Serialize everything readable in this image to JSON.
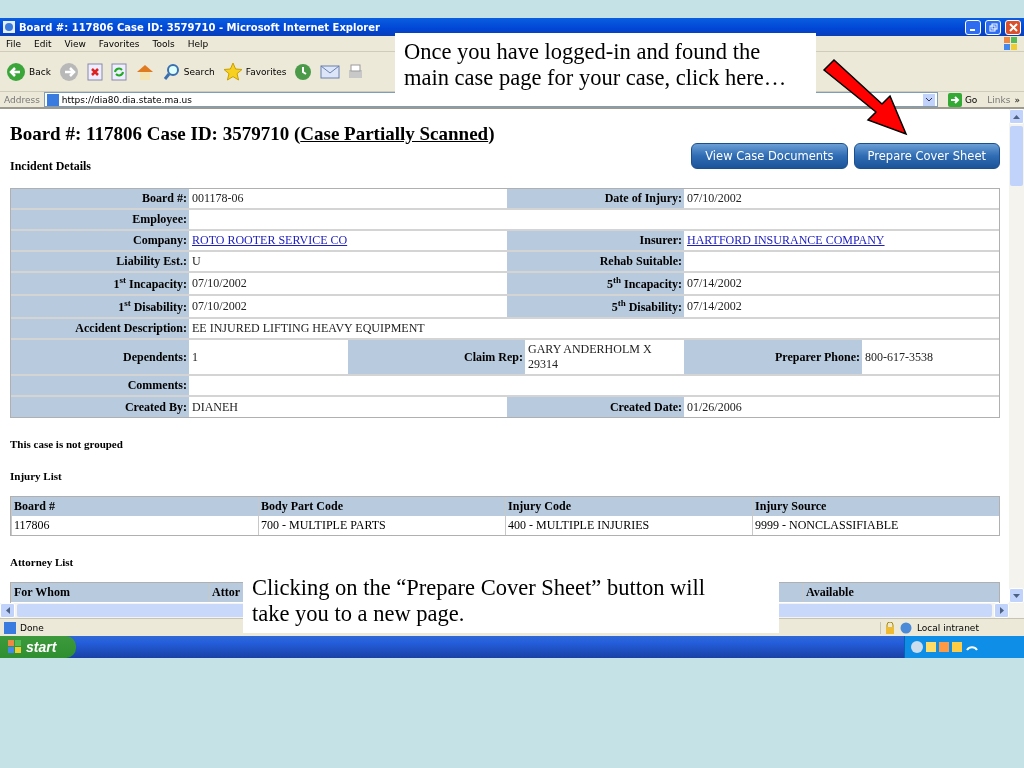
{
  "window": {
    "title": "Board #: 117806 Case ID: 3579710 - Microsoft Internet Explorer"
  },
  "menu": [
    "File",
    "Edit",
    "View",
    "Favorites",
    "Tools",
    "Help"
  ],
  "toolbar": [
    {
      "kind": "back",
      "label": "Back"
    },
    {
      "kind": "forward"
    },
    {
      "kind": "stop"
    },
    {
      "kind": "refresh"
    },
    {
      "kind": "home"
    },
    {
      "kind": "search",
      "label": "Search"
    },
    {
      "kind": "favorites",
      "label": "Favorites"
    },
    {
      "kind": "history"
    },
    {
      "kind": "mail"
    },
    {
      "kind": "print"
    }
  ],
  "address": {
    "label": "Address",
    "value": "https://dia80.dia.state.ma.us",
    "go": "Go",
    "links": "Links",
    "more": "»"
  },
  "page": {
    "title": {
      "before": "Board #: 117806 Case ID: 3579710 (",
      "link": "Case Partially Scanned",
      "after": ")"
    },
    "buttons": [
      "View Case Documents",
      "Prepare Cover Sheet"
    ],
    "section": "Incident Details",
    "details": [
      [
        {
          "label": "Board #:",
          "value": "001178-06",
          "kind": "text"
        },
        {
          "label": "Date of Injury:",
          "value": "07/10/2002",
          "kind": "text"
        }
      ],
      [
        {
          "label": "Employee:",
          "kind": "text"
        }
      ],
      [
        {
          "label": "Company:",
          "value": "ROTO ROOTER SERVICE CO",
          "kind": "link"
        },
        {
          "label": "Insurer:",
          "value": "HARTFORD INSURANCE COMPANY",
          "kind": "link"
        }
      ],
      [
        {
          "label": "Liability Est.:",
          "value": "U",
          "kind": "text"
        },
        {
          "label": "Rehab Suitable:",
          "kind": "text"
        }
      ],
      [
        {
          "label": "1$^{st}$ Incapacity:",
          "value": "07/10/2002",
          "kind": "text"
        },
        {
          "label": "5$^{th}$ Incapacity:",
          "value": "07/14/2002",
          "kind": "text"
        }
      ],
      [
        {
          "label": "1$^{st}$ Disability:",
          "value": "07/10/2002",
          "kind": "text"
        },
        {
          "label": "5$^{th}$ Disability:",
          "value": "07/14/2002",
          "kind": "text"
        }
      ],
      [
        {
          "label": "Accident Description:",
          "value": "EE INJURED LIFTING HEAVY EQUIPMENT",
          "kind": "text"
        }
      ],
      [
        {
          "label": "Dependents:",
          "value": "1",
          "kind": "text"
        },
        {
          "label": "Claim Rep:",
          "value": "GARY ANDERHOLM X 29314",
          "kind": "text"
        },
        {
          "label": "Preparer Phone:",
          "value": "800-617-3538",
          "kind": "text"
        }
      ],
      [
        {
          "label": "Comments:",
          "kind": "text"
        }
      ],
      [
        {
          "label": "Created By:",
          "value": "DIANEH",
          "kind": "text"
        },
        {
          "label": "Created Date:",
          "value": "01/26/2006",
          "kind": "text"
        }
      ]
    ],
    "grouping": "This case is not grouped",
    "injury_list": {
      "title": "Injury List",
      "columns": [
        "Board #",
        "Body Part Code",
        "Injury Code",
        "Injury Source"
      ],
      "rows": [
        [
          "117806",
          "700 - MULTIPLE PARTS",
          "400 - MULTIPLE INJURIES",
          "9999 - NONCLASSIFIABLE"
        ]
      ]
    },
    "attorney_list": {
      "title": "Attorney List",
      "columns": [
        "For Whom",
        "Attor",
        "Available"
      ]
    }
  },
  "status_bar": {
    "text": "Done",
    "zone": "Local intranet"
  },
  "taskbar": {
    "start": "start"
  },
  "callouts": [
    "Once you have logged-in and found the main case page for your case, click here…",
    "Clicking on the “Prepare Cover Sheet” button will take you to a new page."
  ]
}
